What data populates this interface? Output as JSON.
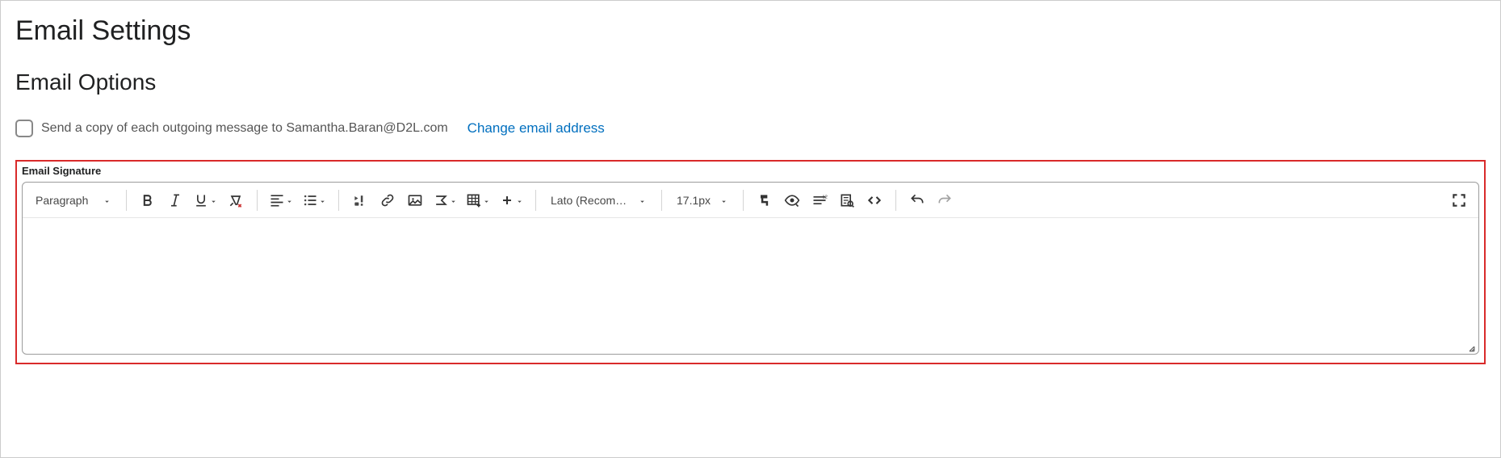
{
  "page": {
    "title": "Email Settings",
    "section": "Email Options"
  },
  "option": {
    "send_copy_label": "Send a copy of each outgoing message to Samantha.Baran@D2L.com",
    "change_link": "Change email address"
  },
  "signature": {
    "label": "Email Signature"
  },
  "toolbar": {
    "paragraph": "Paragraph",
    "font": "Lato (Recomm…",
    "size": "17.1px"
  }
}
